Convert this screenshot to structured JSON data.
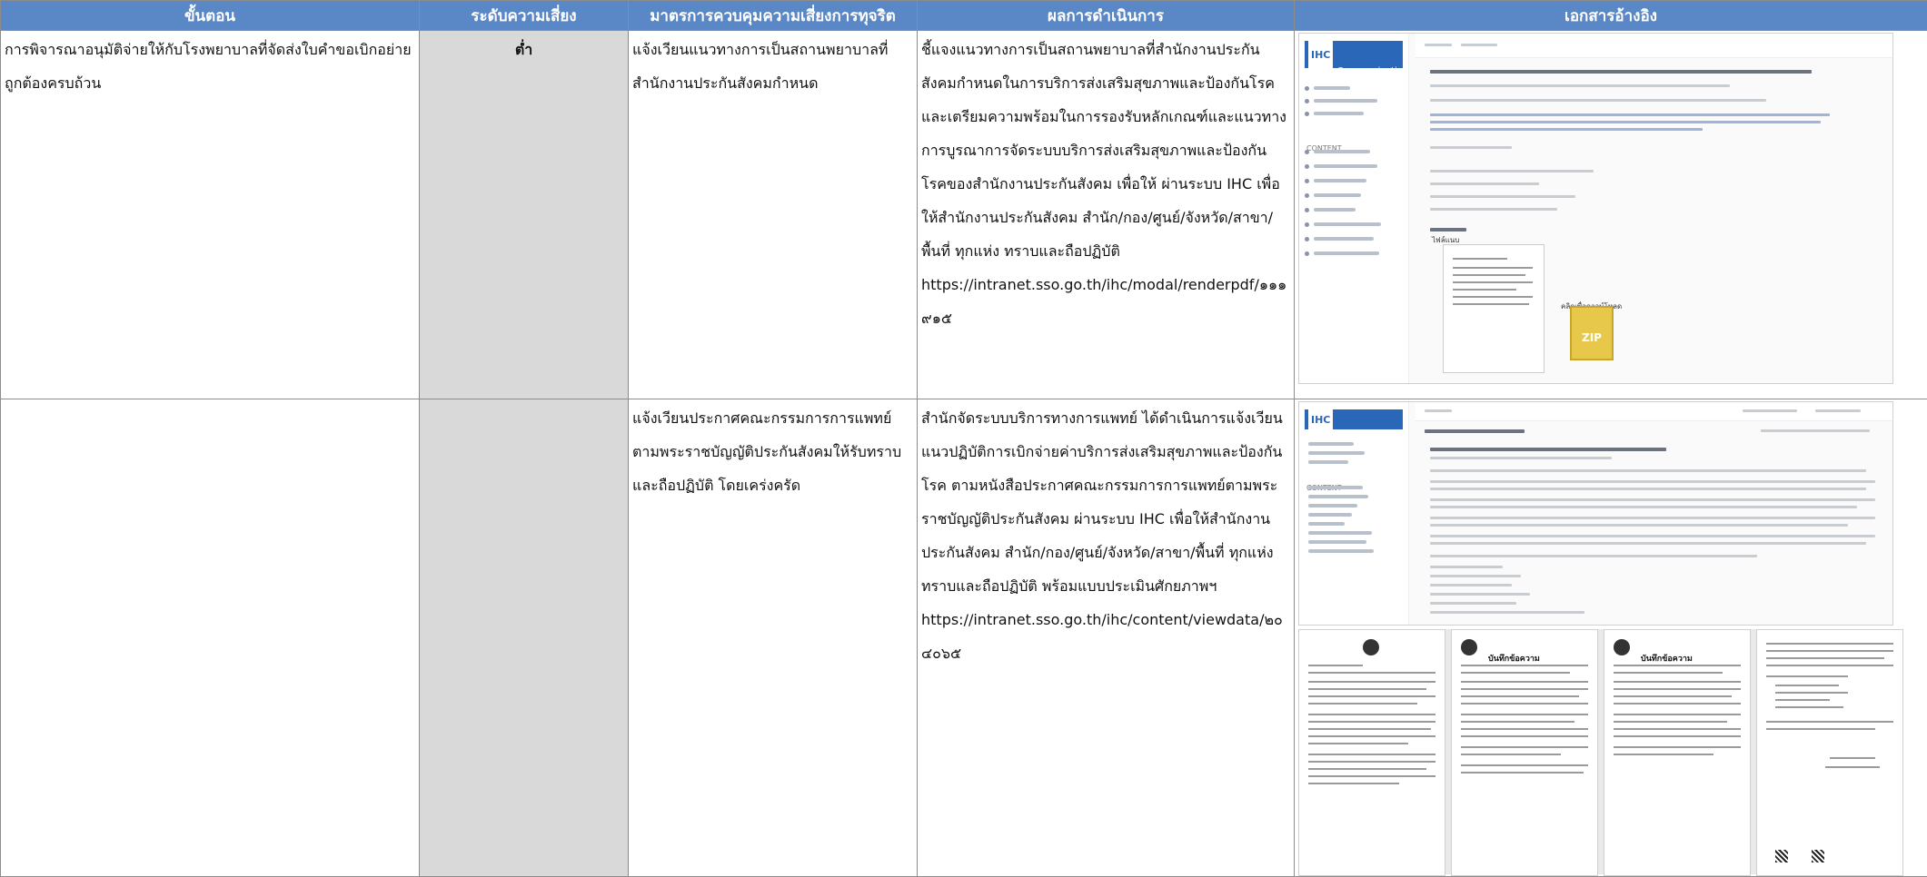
{
  "table": {
    "headers": [
      "ขั้นตอน",
      "ระดับความเสี่ยง",
      "มาตรการควบคุมความเสี่ยงการทุจริต",
      "ผลการดำเนินการ",
      "เอกสารอ้างอิง"
    ],
    "rows": [
      {
        "step": "การพิจารณาอนุมัติจ่ายให้กับโรงพยาบาลที่จัดส่งใบคำขอเบิกอย่ายถูกต้องครบถ้วน",
        "risk_level": "ต่ำ",
        "measure": "แจ้งเวียนแนวทางการเป็นสถานพยาบาลที่สำนักงานประกันสังคมกำหนด",
        "result": "ชี้แจงแนวทางการเป็นสถานพยาบาลที่สำนักงานประกันสังคมกำหนดในการบริการส่งเสริมสุขภาพและป้องกันโรคและเตรียมความพร้อมในการรองรับหลักเกณฑ์และแนวทางการบูรณาการจัดระบบบริการส่งเสริมสุขภาพและป้องกันโรคของสำนักงานประกันสังคม เพื่อให้ ผ่านระบบ IHC เพื่อให้สำนักงานประกันสังคม สำนัก/กอง/ศูนย์/จังหวัด/สาขา/พื้นที่ ทุกแห่ง ทราบและถือปฏิบัติ",
        "result_url": "https://intranet.sso.go.th/ihc/modal/renderpdf/๑๑๑๙๑๕"
      },
      {
        "step": "",
        "risk_level": "",
        "measure": "แจ้งเวียนประกาศคณะกรรมการการแพทย์ตามพระราชบัญญัติประกันสังคมให้รับทราบและถือปฏิบัติ โดยเคร่งครัด",
        "result": "สำนักจัดระบบบริการทางการแพทย์ ได้ดำเนินการแจ้งเวียนแนวปฏิบัติการเบิกจ่ายค่าบริการส่งเสริมสุขภาพและป้องกันโรค ตามหนังสือประกาศคณะกรรมการการแพทย์ตามพระราชบัญญัติประกันสังคม ผ่านระบบ IHC เพื่อให้สำนักงานประกันสังคม สำนัก/กอง/ศูนย์/จังหวัด/สาขา/พื้นที่ ทุกแห่ง ทราบและถือปฏิบัติ พร้อมแบบประเมินศักยภาพฯ",
        "result_url": "https://intranet.sso.go.th/ihc/content/viewdata/๒๐๔๐๖๕"
      }
    ]
  },
  "refs": {
    "shot1": {
      "logo_ihc": "IHC",
      "logo_text": "In House Communication",
      "sidebar_category": "CONTENT",
      "zip_label": "ZIP",
      "zip_caption": "คลิกเพื่อดาวน์โหลด",
      "attachments_label": "ไฟล์แนบ"
    },
    "shot2": {
      "logo_ihc": "IHC",
      "sidebar_category": "CONTENT"
    },
    "memo_title": "บันทึกข้อความ"
  },
  "colors": {
    "header_bg": "#5a87c5",
    "header_text": "#ffffff",
    "risk_column_bg": "#d9d9d9"
  }
}
